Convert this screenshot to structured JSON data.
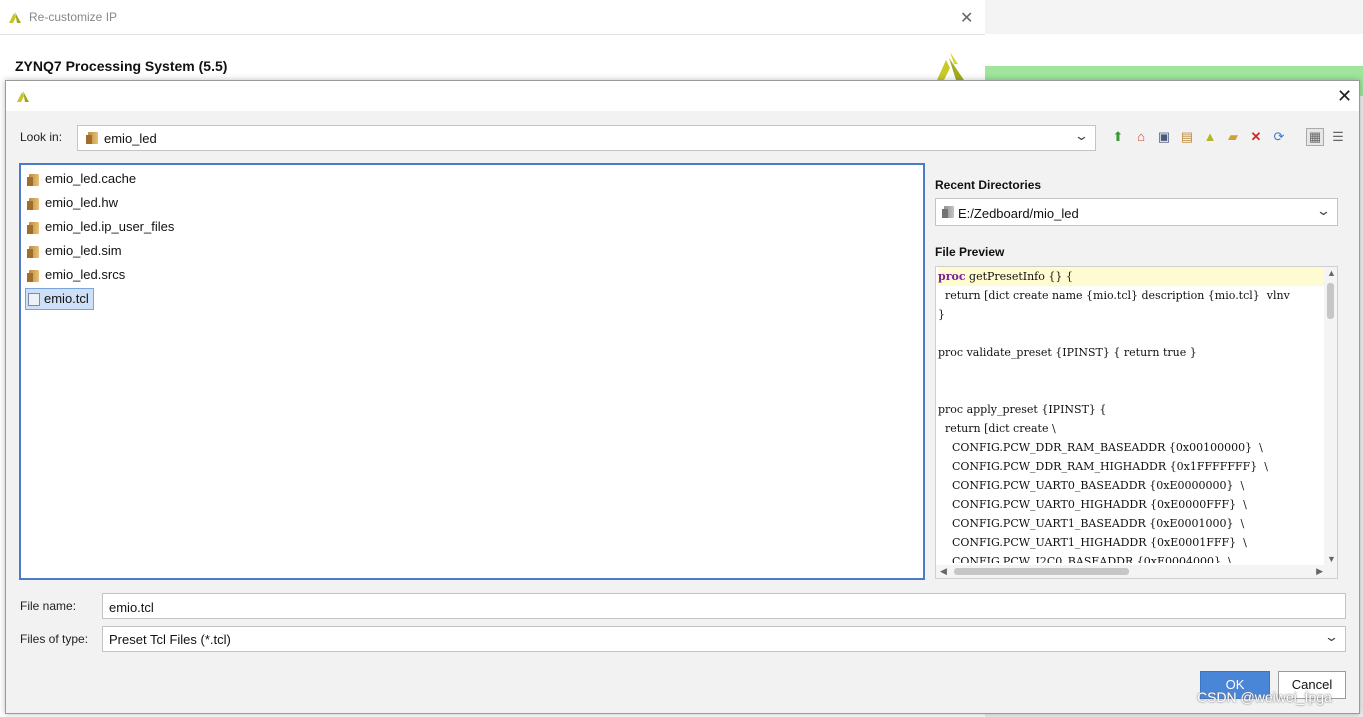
{
  "background_window": {
    "title": "Re-customize IP",
    "heading": "ZYNQ7 Processing System (5.5)",
    "close_glyph": "✕"
  },
  "dialog": {
    "close_glyph": "✕",
    "look_in": {
      "label": "Look in:",
      "value": "emio_led"
    },
    "toolbar_icons": [
      "up-folder-icon",
      "home-icon",
      "computer-icon",
      "project-folder-icon",
      "vivado-icon",
      "new-folder-icon",
      "delete-icon",
      "refresh-icon",
      "list-view-icon",
      "details-view-icon"
    ],
    "files": [
      {
        "name": "emio_led.cache",
        "type": "folder"
      },
      {
        "name": "emio_led.hw",
        "type": "folder"
      },
      {
        "name": "emio_led.ip_user_files",
        "type": "folder"
      },
      {
        "name": "emio_led.sim",
        "type": "folder"
      },
      {
        "name": "emio_led.srcs",
        "type": "folder"
      },
      {
        "name": "emio.tcl",
        "type": "file",
        "selected": true
      }
    ],
    "recent_directories": {
      "title": "Recent Directories",
      "value": "E:/Zedboard/mio_led"
    },
    "file_preview": {
      "title": "File Preview",
      "lines": [
        "proc getPresetInfo {} {",
        "  return [dict create name {mio.tcl} description {mio.tcl}  vlnv",
        "}",
        "",
        "proc validate_preset {IPINST} { return true }",
        "",
        "",
        "proc apply_preset {IPINST} {",
        "  return [dict create \\",
        "    CONFIG.PCW_DDR_RAM_BASEADDR {0x00100000}  \\",
        "    CONFIG.PCW_DDR_RAM_HIGHADDR {0x1FFFFFFF}  \\",
        "    CONFIG.PCW_UART0_BASEADDR {0xE0000000}  \\",
        "    CONFIG.PCW_UART0_HIGHADDR {0xE0000FFF}  \\",
        "    CONFIG.PCW_UART1_BASEADDR {0xE0001000}  \\",
        "    CONFIG.PCW_UART1_HIGHADDR {0xE0001FFF}  \\",
        "    CONFIG.PCW_I2C0_BASEADDR {0xE0004000}  \\"
      ]
    },
    "file_name": {
      "label": "File name:",
      "value": "emio.tcl"
    },
    "files_of_type": {
      "label": "Files of type:",
      "value": "Preset Tcl Files (*.tcl)"
    },
    "ok_label": "OK",
    "cancel_label": "Cancel"
  },
  "watermark": "CSDN @weiwei_fpga",
  "colors": {
    "accent": "#4a86d8",
    "selection": "#cde0f7",
    "keyword": "#7a1fa2",
    "green_bar": "#9fe59c"
  }
}
